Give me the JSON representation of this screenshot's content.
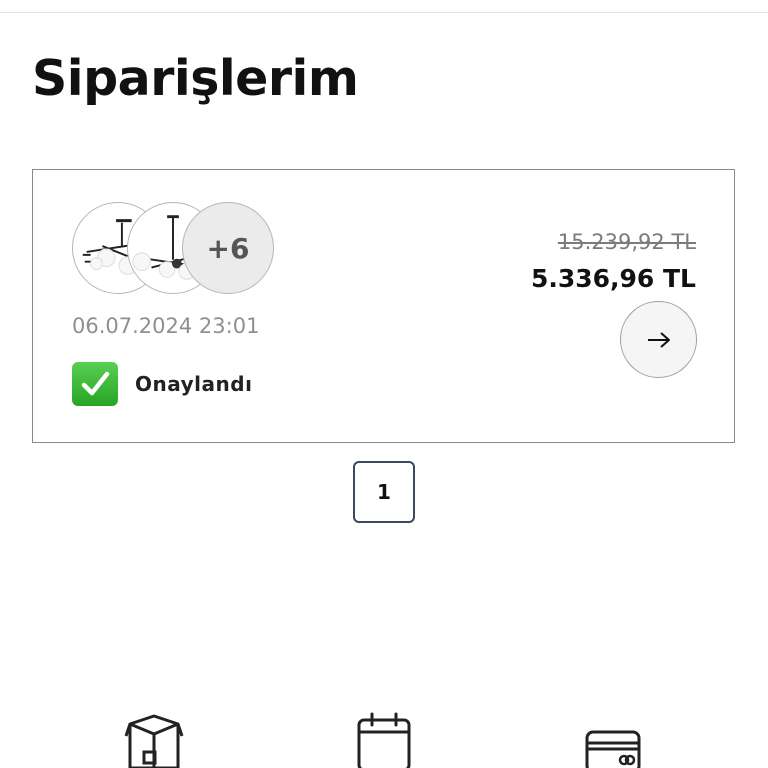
{
  "page": {
    "title": "Siparişlerim"
  },
  "order": {
    "extra_items_label": "+6",
    "date": "06.07.2024 23:01",
    "status": "Onaylandı",
    "old_price": "15.239,92 TL",
    "price": "5.336,96 TL",
    "thumbnails": [
      "chandelier-thumbnail",
      "pendant-lamp-thumbnail"
    ]
  },
  "pagination": {
    "current_page": "1"
  },
  "bottom_nav": {
    "icons": [
      "box-icon",
      "calendar-icon",
      "card-icon"
    ]
  },
  "colors": {
    "status_green": "#2fb52b",
    "pagination_border": "#3b4a5e",
    "card_border": "#8a8a8a"
  }
}
